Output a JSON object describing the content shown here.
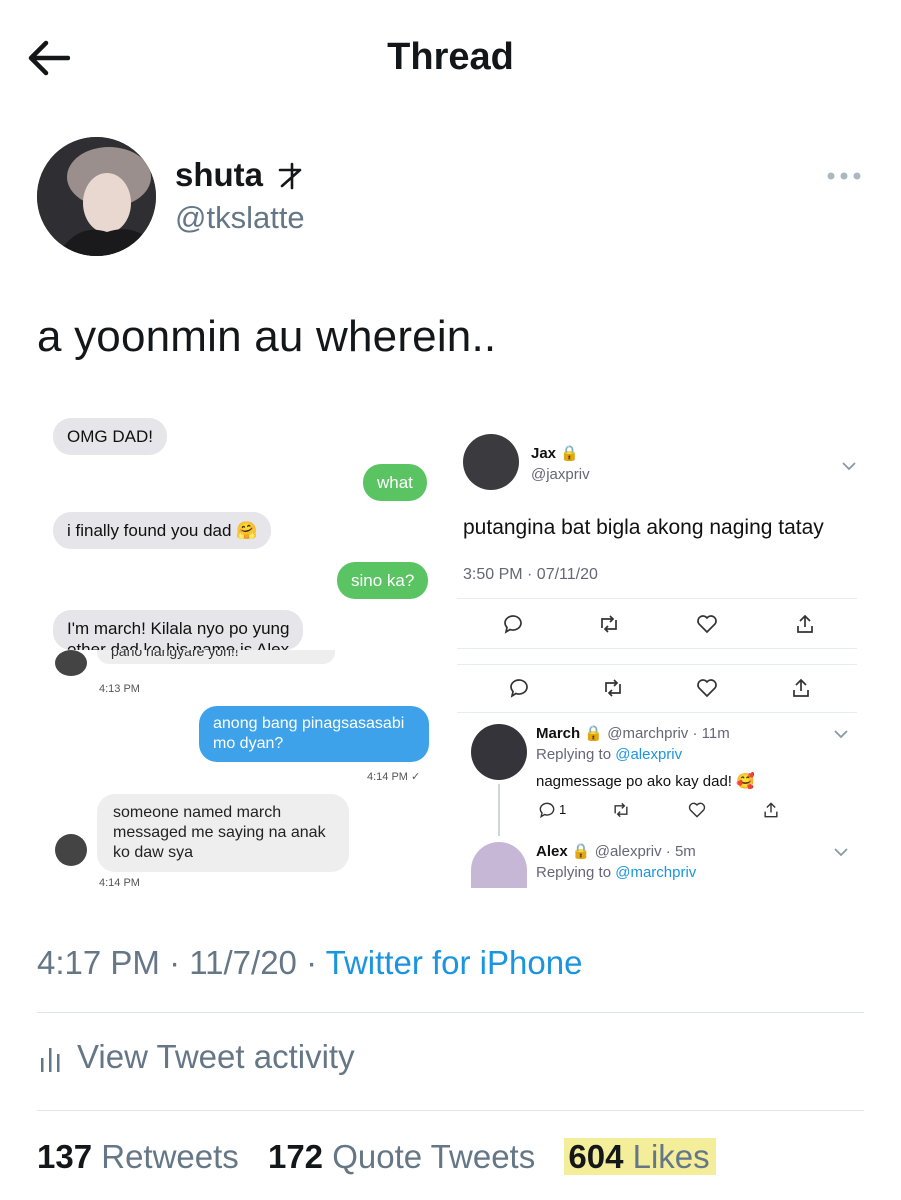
{
  "header": {
    "title": "Thread",
    "back_icon": "back-arrow-icon"
  },
  "author": {
    "name": "shuta",
    "name_glyph": "ᵏ",
    "handle": "@tkslatte"
  },
  "tweet": {
    "text": "a yoonmin au wherein..",
    "time": "4:17 PM",
    "date": "11/7/20",
    "source": "Twitter for iPhone"
  },
  "embedded": {
    "chat": {
      "msg1": "OMG DAD!",
      "msg2": "what",
      "msg3": "i finally found you dad 🤗",
      "msg4": "sino ka?",
      "msg5": "I'm march! Kilala nyo po yung",
      "msg5b": "other dad ko his name is Alex",
      "msg6_partial": "pano nangyare yon!!",
      "ts1": "4:13 PM",
      "msg7": "anong bang pinagsasasabi mo dyan?",
      "ts2": "4:14 PM ✓",
      "msg8": "someone named march messaged me saying na anak ko daw sya",
      "ts3": "4:14 PM"
    },
    "jax": {
      "name": "Jax",
      "handle": "@jaxpriv",
      "text": "putangina bat bigla akong naging tatay",
      "time": "3:50 PM · 07/11/20"
    },
    "march": {
      "name": "March",
      "handle": "@marchpriv · 11m",
      "replying": "Replying to",
      "replying_handle": "@alexpriv",
      "text": "nagmessage po ako kay dad! 🥰",
      "reply_count": "1"
    },
    "alex": {
      "name": "Alex",
      "handle": "@alexpriv · 5m",
      "replying": "Replying to",
      "replying_handle": "@marchpriv"
    }
  },
  "activity": {
    "label": "View Tweet activity"
  },
  "stats": {
    "retweets_count": "137",
    "retweets_label": "Retweets",
    "quotes_count": "172",
    "quotes_label": "Quote Tweets",
    "likes_count": "604",
    "likes_label": "Likes"
  },
  "colors": {
    "link": "#1b95e0",
    "muted": "#657786",
    "highlight": "#f4ee9a"
  }
}
